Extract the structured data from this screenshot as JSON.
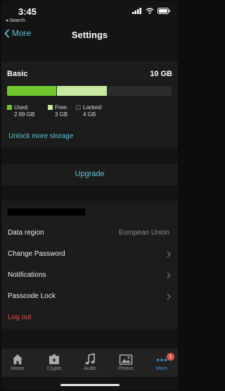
{
  "status_bar": {
    "time": "3:45",
    "back_app": "◂ Search"
  },
  "nav": {
    "back_label": "More",
    "title": "Settings"
  },
  "storage": {
    "plan": "Basic",
    "total": "10 GB",
    "used_fraction": 0.299,
    "free_fraction": 0.3,
    "legend": [
      {
        "label": "Used:",
        "value": "2.99 GB",
        "color": "#70c72e"
      },
      {
        "label": "Free:",
        "value": "3 GB",
        "color": "#c6eaa2"
      },
      {
        "label": "Locked:",
        "value": "4 GB",
        "color": "#2b2b2b"
      }
    ],
    "unlock_label": "Unlock more storage"
  },
  "upgrade": {
    "label": "Upgrade"
  },
  "settings": {
    "data_region_label": "Data region",
    "data_region_value": "European Union",
    "change_password": "Change Password",
    "notifications": "Notifications",
    "passcode_lock": "Passcode Lock",
    "logout": "Log out"
  },
  "tabs": [
    {
      "label": "Home",
      "icon": "home-icon"
    },
    {
      "label": "Crypto",
      "icon": "crypto-icon"
    },
    {
      "label": "Audio",
      "icon": "music-note-icon"
    },
    {
      "label": "Photos",
      "icon": "photos-icon"
    },
    {
      "label": "More",
      "icon": "more-icon"
    }
  ],
  "more_badge": "1",
  "colors": {
    "accent": "#5ec3d6",
    "danger": "#e0534a",
    "active_tab": "#3c8fd8"
  }
}
